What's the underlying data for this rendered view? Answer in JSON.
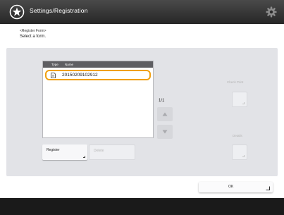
{
  "window": {
    "title": "Settings/Registration"
  },
  "header": {
    "heading": "<Register Form>",
    "instruction": "Select a form."
  },
  "list": {
    "columns": [
      "Type",
      "Name"
    ],
    "items": [
      {
        "name": "20150209102912",
        "selected": true
      }
    ]
  },
  "pagination": {
    "page_label": "1/1"
  },
  "buttons": {
    "register": "Register",
    "delete": "Delete",
    "check_print": "Check Print",
    "details": "Details",
    "ok": "OK"
  },
  "colors": {
    "titlebar": "#2f2f2f",
    "selection_border": "#f0a010",
    "panel": "#e2e3e7",
    "footer": "#1a1a1a"
  }
}
